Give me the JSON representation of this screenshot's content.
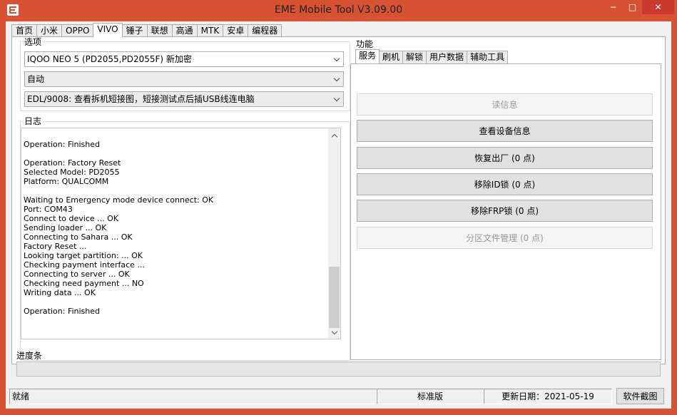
{
  "window": {
    "title": "EME Mobile Tool V3.09.00",
    "min_icon": "−",
    "max_icon": "□",
    "close_icon": "✕"
  },
  "tabs": [
    "首页",
    "小米",
    "OPPO",
    "VIVO",
    "锤子",
    "联想",
    "高通",
    "MTK",
    "安卓",
    "编程器"
  ],
  "active_tab": "VIVO",
  "options": {
    "label": "选项",
    "model": "IQOO NEO 5 (PD2055,PD2055F) 新加密",
    "mode": "自动",
    "connection": "EDL/9008: 查看拆机短接图，短接测试点后插USB线连电脑"
  },
  "log": {
    "label": "日志",
    "lines": [
      "Operation: Finished",
      "",
      "Operation: Factory Reset",
      "Selected Model: PD2055",
      "Platform: QUALCOMM",
      "",
      "Waiting to Emergency mode device connect: OK",
      "Port: COM43",
      "Connect to device ... OK",
      "Sending loader ... OK",
      "Connecting to Sahara ... OK",
      "Factory Reset ...",
      "Looking target partition: ... OK",
      "Checking payment interface ...",
      "Connecting to server ... OK",
      "Checking need payment ... NO",
      "Writing data ... OK",
      "",
      "Operation: Finished"
    ]
  },
  "function": {
    "label": "功能",
    "subtabs": [
      "服务",
      "刷机",
      "解锁",
      "用户数据",
      "辅助工具"
    ],
    "active_subtab": "服务",
    "buttons": {
      "read_info": "读信息",
      "view_device": "查看设备信息",
      "factory_reset": "恢复出厂 (0 点)",
      "remove_id": "移除ID锁 (0 点)",
      "remove_frp": "移除FRP锁 (0 点)",
      "partition_mgr": "分区文件管理 (0 点)"
    }
  },
  "progress": {
    "label": "进度条",
    "value": 0
  },
  "statusbar": {
    "state": "就绪",
    "edition": "标准版",
    "update_date": "更新日期：2021-05-19",
    "screenshot_button": "软件截图"
  }
}
